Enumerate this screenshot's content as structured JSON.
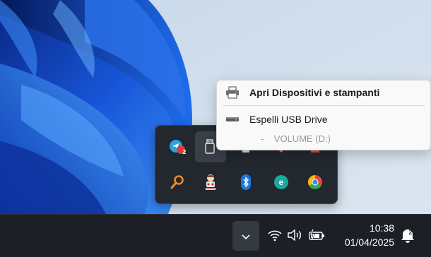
{
  "context_menu": {
    "items": [
      {
        "label": "Apri Dispositivi e stampanti",
        "icon": "printer-icon",
        "bold": true
      },
      {
        "label": "Espelli USB Drive",
        "icon": "usb-drive-icon",
        "bold": false
      }
    ],
    "sub_item": {
      "dash": "-",
      "label": "VOLUME (D:)"
    }
  },
  "tray_flyout": {
    "icons": [
      {
        "name": "telegram-icon",
        "badge": "2"
      },
      {
        "name": "usb-eject-icon"
      },
      {
        "name": "tray-app-icon-3"
      },
      {
        "name": "tray-app-icon-4"
      },
      {
        "name": "tray-app-icon-5"
      },
      {
        "name": "search-tool-icon"
      },
      {
        "name": "character-app-icon"
      },
      {
        "name": "bluetooth-icon"
      },
      {
        "name": "eset-icon",
        "letter": "e"
      },
      {
        "name": "chrome-icon"
      }
    ]
  },
  "taskbar": {
    "clock": {
      "time": "10:38",
      "date": "01/04/2025"
    },
    "notification_count": "2"
  },
  "colors": {
    "taskbar_bg": "#1c2026",
    "flyout_bg": "#23282f",
    "menu_bg": "#f9f9f9",
    "eset_teal": "#1aa9a0",
    "bluetooth_blue": "#1a78e0"
  }
}
